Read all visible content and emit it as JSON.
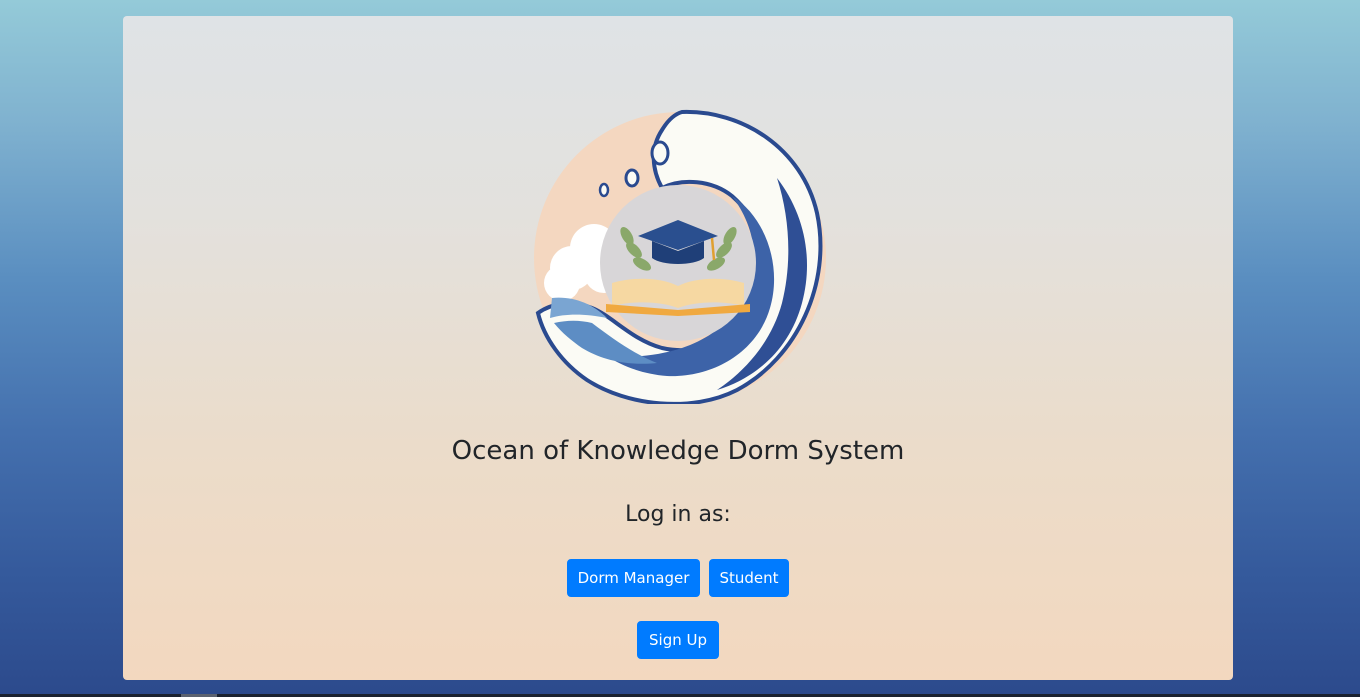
{
  "app": {
    "title": "Ocean of Knowledge Dorm System"
  },
  "login": {
    "prompt": "Log in as:",
    "dorm_manager_label": "Dorm Manager",
    "student_label": "Student",
    "signup_label": "Sign Up"
  },
  "logo": {
    "icon": "wave-graduation-cap-book-logo"
  },
  "colors": {
    "primary_button": "#007bff",
    "heading_text": "#212529",
    "background_top": "#94cad8",
    "background_bottom": "#2c4a8c"
  }
}
